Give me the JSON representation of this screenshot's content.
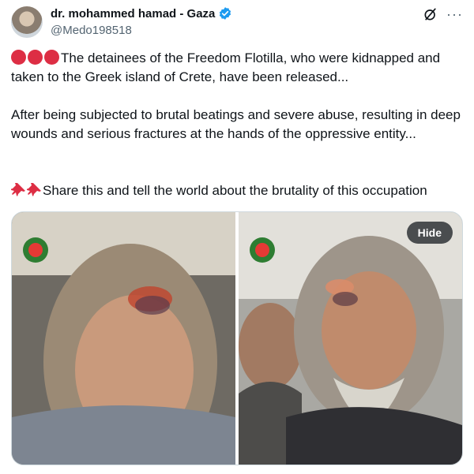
{
  "author": {
    "display_name": "dr. mohammed hamad - Gaza",
    "handle": "@Medo198518"
  },
  "icons": {
    "verified": "verified-badge-icon",
    "grok": "grok-icon",
    "more": "more-options-icon",
    "verified_color": "#1d9bf0"
  },
  "post": {
    "paragraph_1": "The detainees of the Freedom Flotilla, who were kidnapped and taken to the Greek island of Crete, have been released...",
    "paragraph_2": "After being subjected to brutal beatings and severe abuse, resulting in deep wounds and serious fractures at the hands of the oppressive entity...",
    "paragraph_3": "Share this and tell the world about the brutality of this occupation"
  },
  "media": {
    "hide_label": "Hide"
  }
}
